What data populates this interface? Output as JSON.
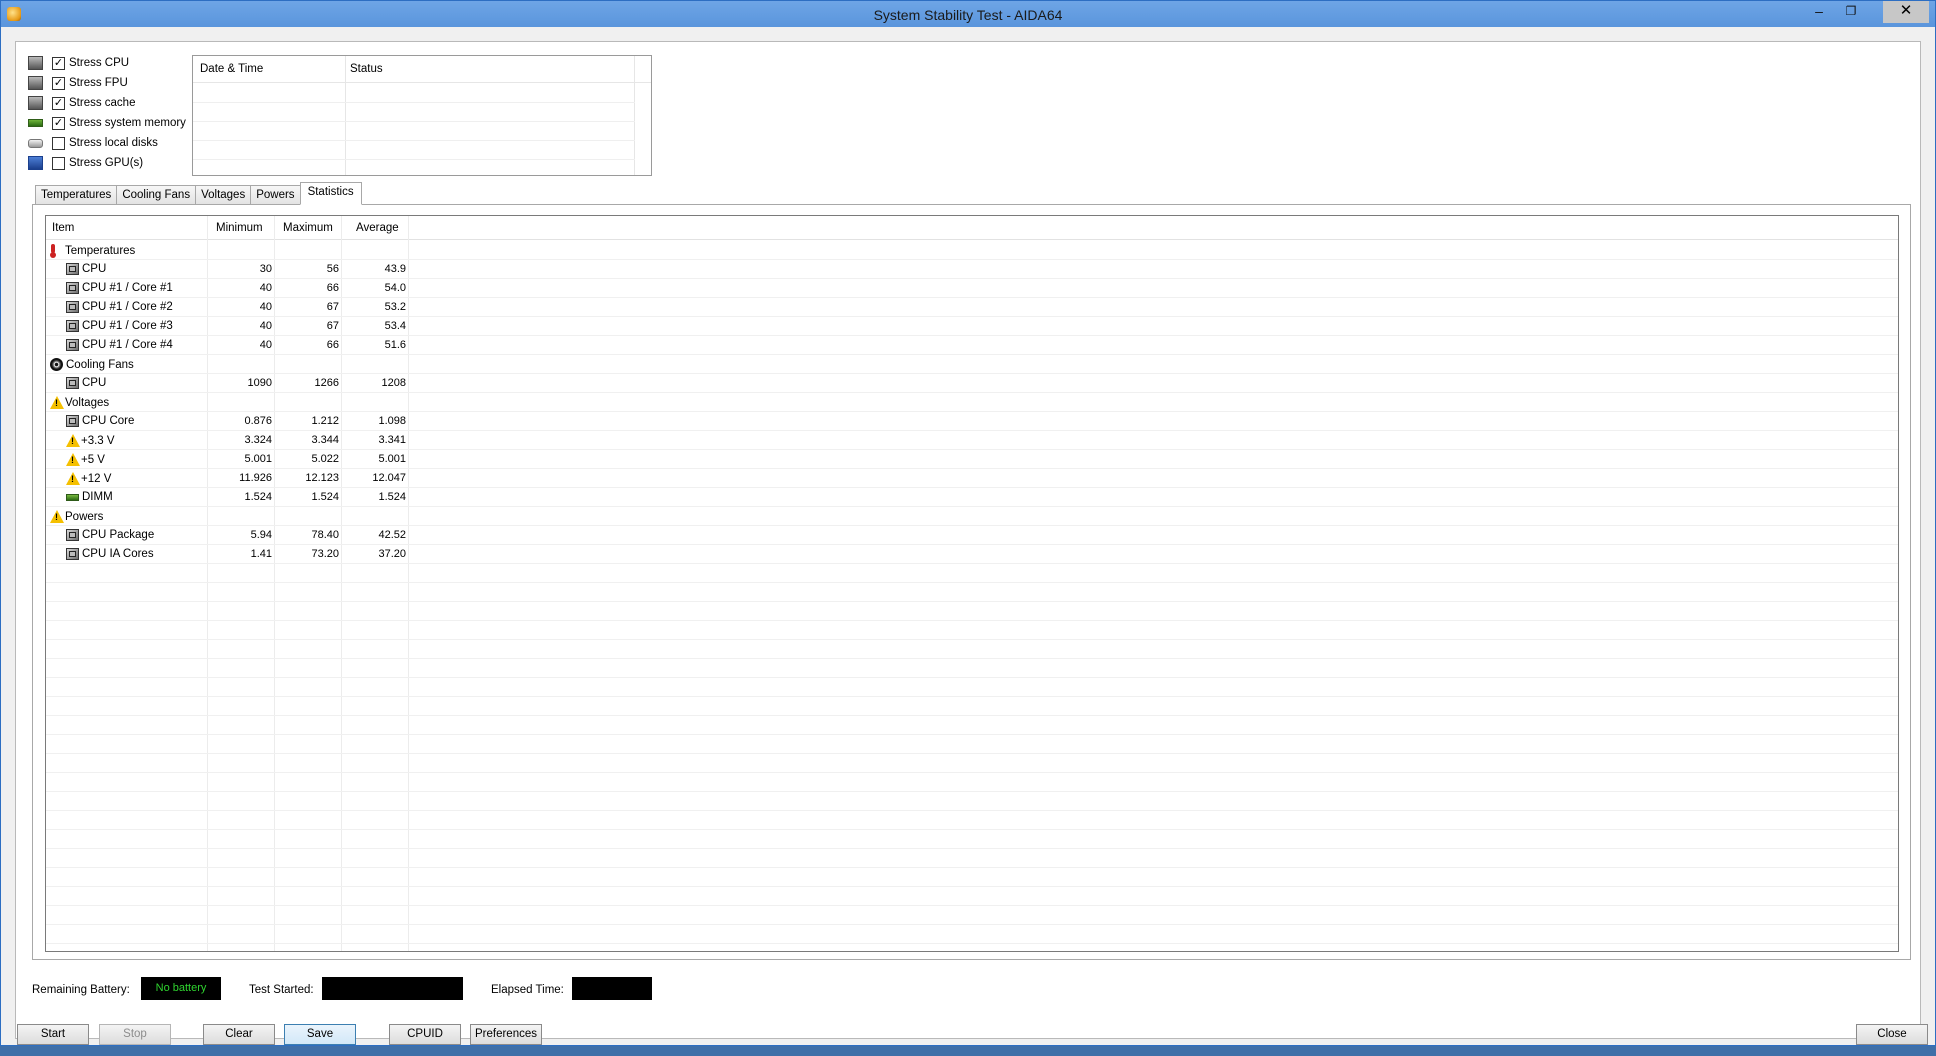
{
  "window": {
    "title": "System Stability Test - AIDA64",
    "min_glyph": "–",
    "max_glyph": "❐",
    "close_glyph": "✕"
  },
  "stress_options": [
    {
      "label": "Stress CPU",
      "checked": true,
      "icon": "cpu-chip-icon"
    },
    {
      "label": "Stress FPU",
      "checked": true,
      "icon": "fpu-icon"
    },
    {
      "label": "Stress cache",
      "checked": true,
      "icon": "cache-icon"
    },
    {
      "label": "Stress system memory",
      "checked": true,
      "icon": "memory-icon"
    },
    {
      "label": "Stress local disks",
      "checked": false,
      "icon": "disk-icon"
    },
    {
      "label": "Stress GPU(s)",
      "checked": false,
      "icon": "gpu-icon"
    }
  ],
  "log": {
    "col_datetime": "Date & Time",
    "col_status": "Status"
  },
  "tabs": [
    "Temperatures",
    "Cooling Fans",
    "Voltages",
    "Powers",
    "Statistics"
  ],
  "stats": {
    "headers": {
      "item": "Item",
      "min": "Minimum",
      "max": "Maximum",
      "avg": "Average"
    },
    "rows": [
      {
        "label": "Temperatures",
        "group": true,
        "icon": "thermometer-icon"
      },
      {
        "label": "CPU",
        "icon": "chip-icon",
        "min": "30",
        "max": "56",
        "avg": "43.9"
      },
      {
        "label": "CPU #1 / Core #1",
        "icon": "chip-icon",
        "min": "40",
        "max": "66",
        "avg": "54.0"
      },
      {
        "label": "CPU #1 / Core #2",
        "icon": "chip-icon",
        "min": "40",
        "max": "67",
        "avg": "53.2"
      },
      {
        "label": "CPU #1 / Core #3",
        "icon": "chip-icon",
        "min": "40",
        "max": "67",
        "avg": "53.4"
      },
      {
        "label": "CPU #1 / Core #4",
        "icon": "chip-icon",
        "min": "40",
        "max": "66",
        "avg": "51.6"
      },
      {
        "label": "Cooling Fans",
        "group": true,
        "icon": "fan-icon"
      },
      {
        "label": "CPU",
        "icon": "chip-icon",
        "min": "1090",
        "max": "1266",
        "avg": "1208"
      },
      {
        "label": "Voltages",
        "group": true,
        "icon": "warning-icon"
      },
      {
        "label": "CPU Core",
        "icon": "chip-icon",
        "min": "0.876",
        "max": "1.212",
        "avg": "1.098"
      },
      {
        "label": "+3.3 V",
        "icon": "warning-icon",
        "min": "3.324",
        "max": "3.344",
        "avg": "3.341"
      },
      {
        "label": "+5 V",
        "icon": "warning-icon",
        "min": "5.001",
        "max": "5.022",
        "avg": "5.001"
      },
      {
        "label": "+12 V",
        "icon": "warning-icon",
        "min": "11.926",
        "max": "12.123",
        "avg": "12.047"
      },
      {
        "label": "DIMM",
        "icon": "dimm-icon",
        "min": "1.524",
        "max": "1.524",
        "avg": "1.524"
      },
      {
        "label": "Powers",
        "group": true,
        "icon": "warning-icon"
      },
      {
        "label": "CPU Package",
        "icon": "chip-icon",
        "min": "5.94",
        "max": "78.40",
        "avg": "42.52"
      },
      {
        "label": "CPU IA Cores",
        "icon": "chip-icon",
        "min": "1.41",
        "max": "73.20",
        "avg": "37.20"
      }
    ]
  },
  "status": {
    "battery_label": "Remaining Battery:",
    "battery_value": "No battery",
    "started_label": "Test Started:",
    "elapsed_label": "Elapsed Time:"
  },
  "buttons": {
    "start": "Start",
    "stop": "Stop",
    "clear": "Clear",
    "save": "Save",
    "cpuid": "CPUID",
    "preferences": "Preferences",
    "close": "Close"
  },
  "colors": {
    "title_bar": "#5a95dc",
    "battery_text": "#2fd42f",
    "warning": "#f5c000"
  }
}
